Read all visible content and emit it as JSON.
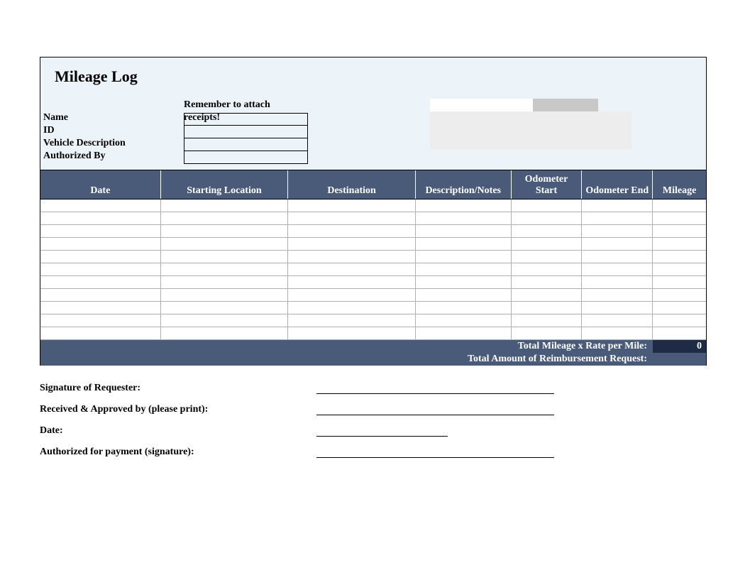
{
  "title": "Mileage Log",
  "reminder": "Remember to attach receipts!",
  "fields": {
    "name": "Name",
    "id": "ID",
    "vehicle": "Vehicle Description",
    "authorized": "Authorized By"
  },
  "columns": {
    "date": "Date",
    "start_loc": "Starting Location",
    "destination": "Destination",
    "description": "Description/Notes",
    "odo_start": "Odometer Start",
    "odo_end": "Odometer End",
    "mileage": "Mileage"
  },
  "totals": {
    "rate_label": "Total Mileage x Rate per Mile:",
    "rate_value": "0",
    "reimb_label": "Total Amount of Reimbursement Request:"
  },
  "signatures": {
    "requester": "Signature of Requester:",
    "approved": "Received & Approved by (please print):",
    "date": "Date:",
    "payment": "Authorized for payment (signature):"
  },
  "row_count": 11
}
